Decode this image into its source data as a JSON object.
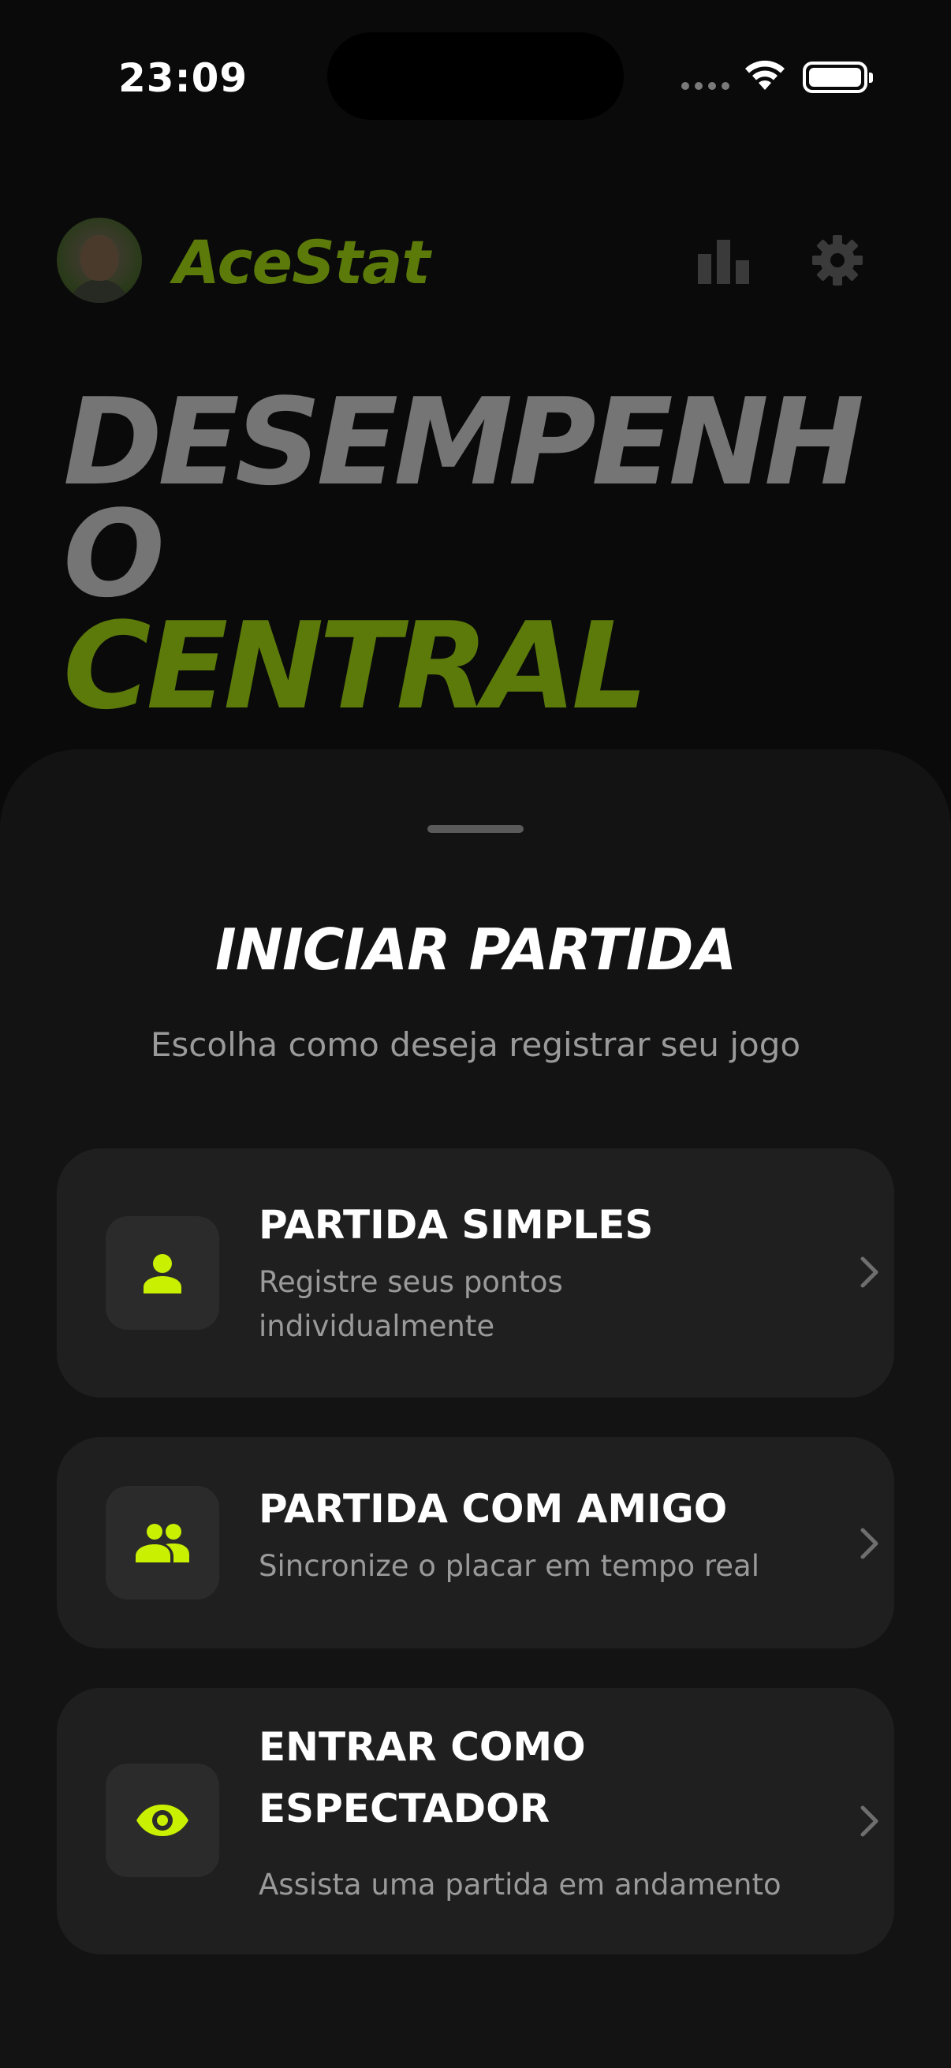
{
  "status_bar": {
    "time": "23:09"
  },
  "header": {
    "app_title": "AceStat",
    "icons": [
      "avatar",
      "bar-chart-icon",
      "gear-icon"
    ]
  },
  "hero": {
    "line1": "DESEMPENH",
    "line2": "O",
    "line3": "CENTRAL"
  },
  "sheet": {
    "title": "INICIAR PARTIDA",
    "subtitle": "Escolha como deseja registrar seu jogo",
    "options": [
      {
        "icon": "person-icon",
        "title": "PARTIDA SIMPLES",
        "description": "Registre seus pontos individualmente"
      },
      {
        "icon": "group-icon",
        "title": "PARTIDA COM AMIGO",
        "description": "Sincronize o placar em tempo real"
      },
      {
        "icon": "eye-icon",
        "title": "ENTRAR COMO ESPECTADOR",
        "description": "Assista uma partida em andamento"
      }
    ]
  },
  "colors": {
    "background": "#0a0a0a",
    "sheet": "#131313",
    "card": "#1f1f1f",
    "accent": "#c8f000",
    "accent_dim": "#5c7a0a",
    "hero_gray": "#757575"
  }
}
